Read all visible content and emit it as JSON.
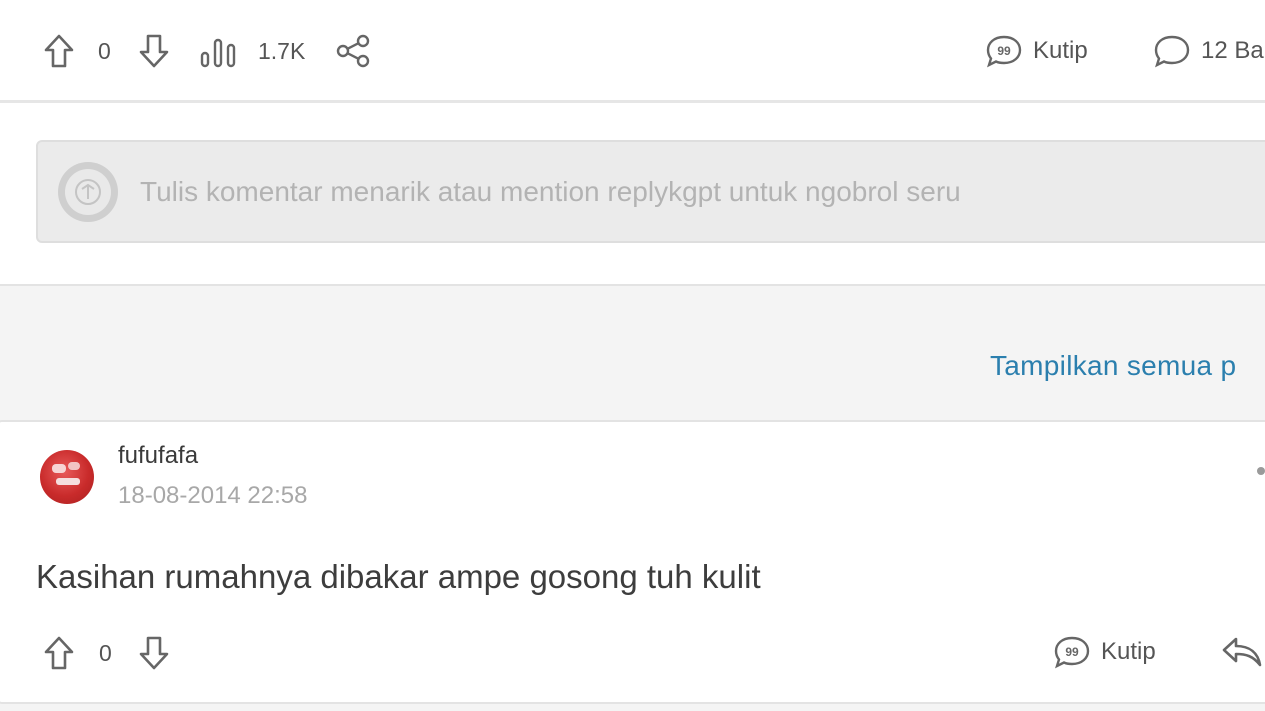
{
  "post_actions": {
    "upvote_count": "0",
    "views_count": "1.7K",
    "quote_label": "Kutip",
    "reply_count_label": "12 Ba"
  },
  "comment_input": {
    "placeholder": "Tulis komentar menarik atau mention replykgpt untuk ngobrol seru"
  },
  "show_all_link": "Tampilkan semua p",
  "reply": {
    "username": "fufufafa",
    "timestamp": "18-08-2014 22:58",
    "text": "Kasihan rumahnya dibakar ampe gosong tuh kulit",
    "vote_count": "0",
    "quote_label": "Kutip"
  },
  "icons": {
    "upvote": "arrow-up-icon",
    "downvote": "arrow-down-icon",
    "views": "bar-chart-icon",
    "share": "share-icon",
    "quote": "quote-bubble-icon",
    "comment": "comment-bubble-icon",
    "reply": "reply-arrow-icon"
  },
  "colors": {
    "link": "#2b7fae",
    "avatar_red": "#c92b2b"
  }
}
